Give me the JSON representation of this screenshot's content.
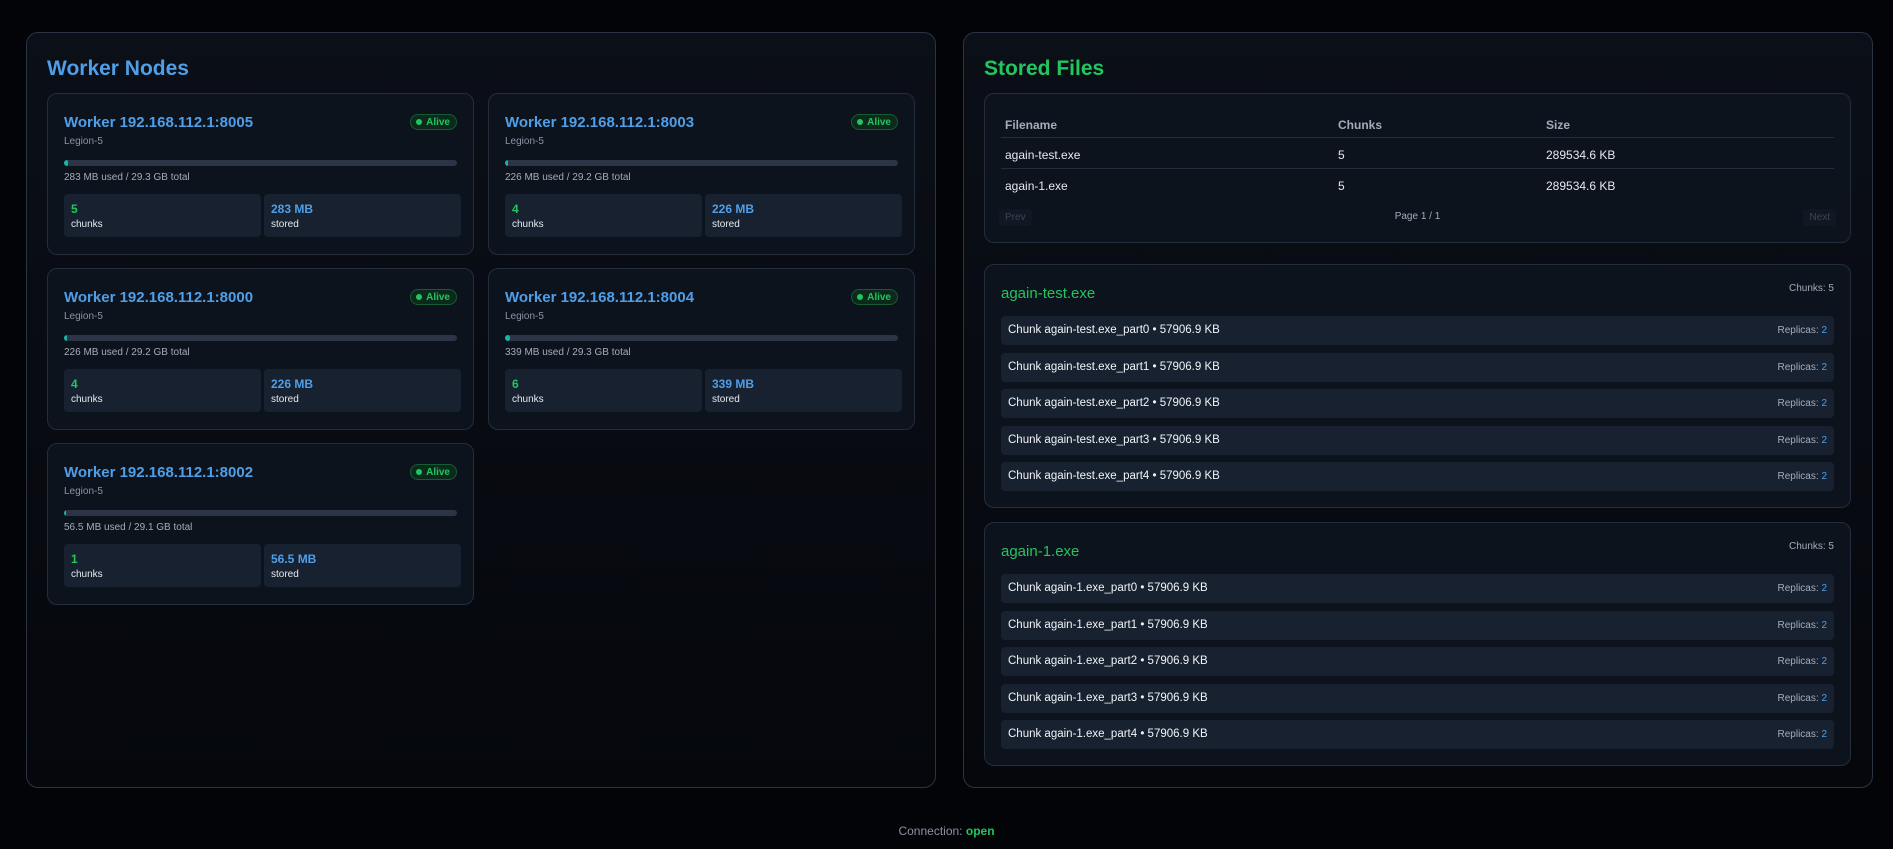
{
  "worker_panel": {
    "title": "Worker Nodes",
    "workers": [
      {
        "title": "Worker 192.168.112.1:8005",
        "host": "Legion-5",
        "status": "Alive",
        "usage": "283 MB used / 29.3 GB total",
        "usage_fraction": 0.01,
        "chunks": "5",
        "chunks_label": "chunks",
        "stored": "283 MB",
        "stored_label": "stored"
      },
      {
        "title": "Worker 192.168.112.1:8003",
        "host": "Legion-5",
        "status": "Alive",
        "usage": "226 MB used / 29.2 GB total",
        "usage_fraction": 0.008,
        "chunks": "4",
        "chunks_label": "chunks",
        "stored": "226 MB",
        "stored_label": "stored"
      },
      {
        "title": "Worker 192.168.112.1:8000",
        "host": "Legion-5",
        "status": "Alive",
        "usage": "226 MB used / 29.2 GB total",
        "usage_fraction": 0.008,
        "chunks": "4",
        "chunks_label": "chunks",
        "stored": "226 MB",
        "stored_label": "stored"
      },
      {
        "title": "Worker 192.168.112.1:8004",
        "host": "Legion-5",
        "status": "Alive",
        "usage": "339 MB used / 29.3 GB total",
        "usage_fraction": 0.012,
        "chunks": "6",
        "chunks_label": "chunks",
        "stored": "339 MB",
        "stored_label": "stored"
      },
      {
        "title": "Worker 192.168.112.1:8002",
        "host": "Legion-5",
        "status": "Alive",
        "usage": "56.5 MB used / 29.1 GB total",
        "usage_fraction": 0.002,
        "chunks": "1",
        "chunks_label": "chunks",
        "stored": "56.5 MB",
        "stored_label": "stored"
      }
    ]
  },
  "files_panel": {
    "title": "Stored Files",
    "table": {
      "headers": [
        "Filename",
        "Chunks",
        "Size"
      ],
      "rows": [
        [
          "again-test.exe",
          "5",
          "289534.6 KB"
        ],
        [
          "again-1.exe",
          "5",
          "289534.6 KB"
        ]
      ],
      "prev_label": "Prev",
      "next_label": "Next",
      "page_info": "Page 1 / 1"
    },
    "file_details": [
      {
        "name": "again-test.exe",
        "chunk_count": "Chunks: 5",
        "chunks": [
          {
            "name": "Chunk again-test.exe_part0 • 57906.9 KB",
            "replicas_label": "Replicas:",
            "replicas": "2"
          },
          {
            "name": "Chunk again-test.exe_part1 • 57906.9 KB",
            "replicas_label": "Replicas:",
            "replicas": "2"
          },
          {
            "name": "Chunk again-test.exe_part2 • 57906.9 KB",
            "replicas_label": "Replicas:",
            "replicas": "2"
          },
          {
            "name": "Chunk again-test.exe_part3 • 57906.9 KB",
            "replicas_label": "Replicas:",
            "replicas": "2"
          },
          {
            "name": "Chunk again-test.exe_part4 • 57906.9 KB",
            "replicas_label": "Replicas:",
            "replicas": "2"
          }
        ]
      },
      {
        "name": "again-1.exe",
        "chunk_count": "Chunks: 5",
        "chunks": [
          {
            "name": "Chunk again-1.exe_part0 • 57906.9 KB",
            "replicas_label": "Replicas:",
            "replicas": "2"
          },
          {
            "name": "Chunk again-1.exe_part1 • 57906.9 KB",
            "replicas_label": "Replicas:",
            "replicas": "2"
          },
          {
            "name": "Chunk again-1.exe_part2 • 57906.9 KB",
            "replicas_label": "Replicas:",
            "replicas": "2"
          },
          {
            "name": "Chunk again-1.exe_part3 • 57906.9 KB",
            "replicas_label": "Replicas:",
            "replicas": "2"
          },
          {
            "name": "Chunk again-1.exe_part4 • 57906.9 KB",
            "replicas_label": "Replicas:",
            "replicas": "2"
          }
        ]
      }
    ]
  },
  "connection": {
    "label": "Connection:",
    "status": "open"
  },
  "colors": {
    "blue_accent": "#4f9fe8",
    "green_accent": "#22c55e",
    "background": "#030407",
    "card": "#0d131d"
  }
}
